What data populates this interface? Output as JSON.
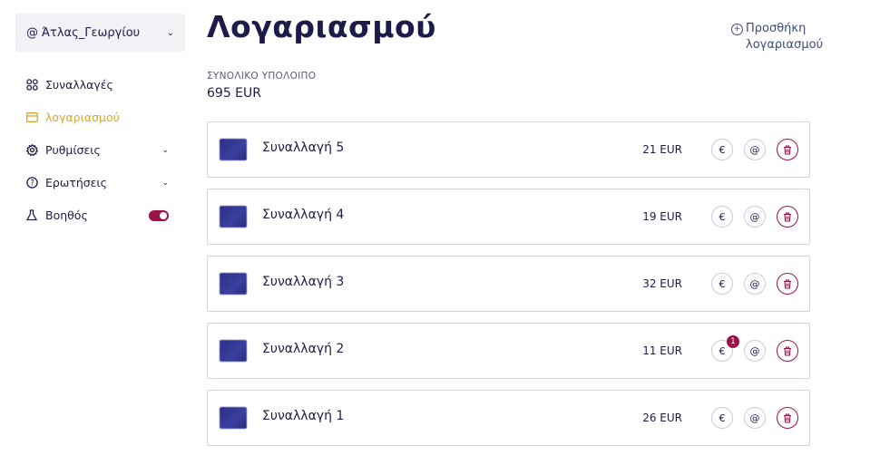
{
  "sidebar": {
    "user": {
      "at_symbol": "@",
      "name": "Άτλας_Γεωργίου",
      "chevron": "⌄"
    },
    "items": [
      {
        "label": "Συναλλαγές",
        "icon": "grid-icon",
        "active": false
      },
      {
        "label": "λογαριασμού",
        "icon": "card-icon",
        "active": true
      },
      {
        "label": "Ρυθμίσεις",
        "icon": "gear-icon",
        "active": false,
        "chevron": true
      },
      {
        "label": "Ερωτήσεις",
        "icon": "question-icon",
        "active": false,
        "chevron": true
      },
      {
        "label": "Βοηθός",
        "icon": "flask-icon",
        "active": false,
        "toggle": true
      }
    ]
  },
  "header": {
    "title": "Λογαριασμού",
    "add_link": "Προσθήκη λογαριασμού"
  },
  "balance": {
    "label": "ΣΥΝΟΛΙΚΟ ΥΠΟΛΟΙΠΟ",
    "value": "695 EUR"
  },
  "transactions": [
    {
      "name": "Συναλλαγή 5",
      "amount": "21 EUR"
    },
    {
      "name": "Συναλλαγή 4",
      "amount": "19 EUR"
    },
    {
      "name": "Συναλλαγή 3",
      "amount": "32 EUR"
    },
    {
      "name": "Συναλλαγή 2",
      "amount": "11 EUR",
      "badge": "1"
    },
    {
      "name": "Συναλλαγή 1",
      "amount": "26 EUR"
    }
  ],
  "actions": {
    "euro": "€",
    "at": "@",
    "del": "🗑"
  },
  "colors": {
    "accent": "#9c1247",
    "active": "#d8a72a",
    "text": "#1d1b4a"
  }
}
